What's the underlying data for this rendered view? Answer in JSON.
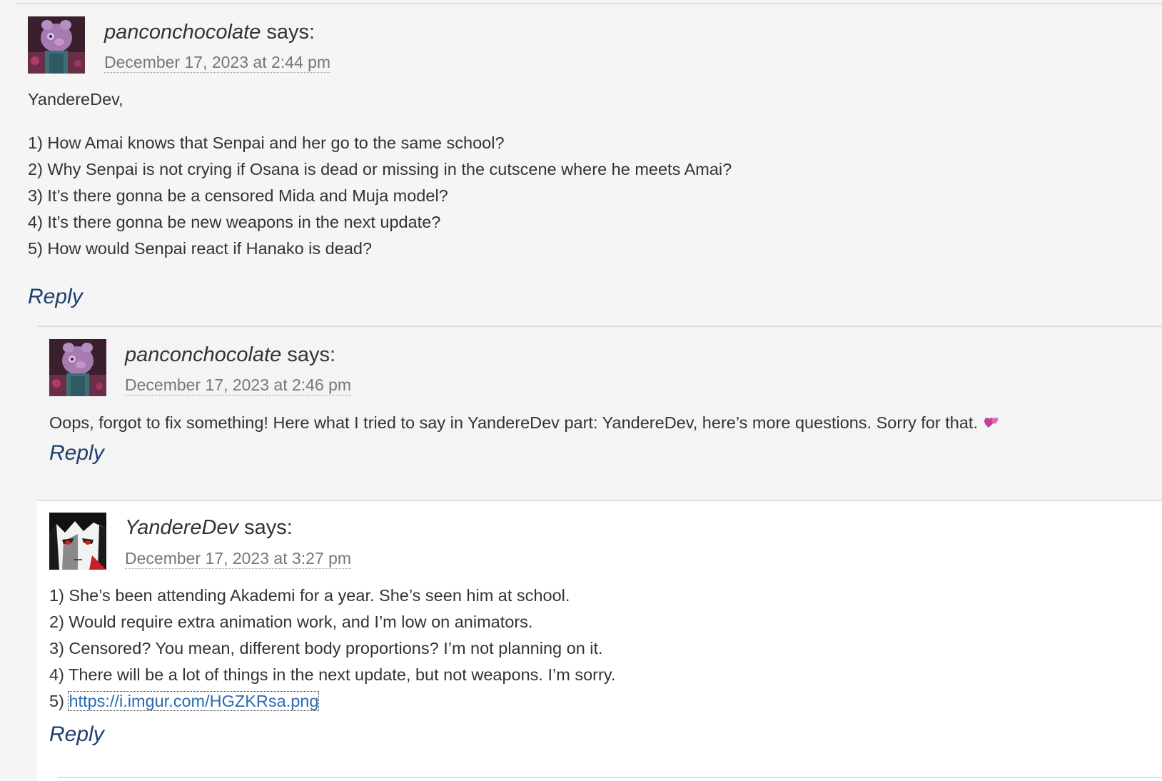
{
  "comments": [
    {
      "author": "panconchocolate",
      "says": "says:",
      "date": "December 17, 2023 at 2:44 pm",
      "avatar_icon": "pink-pig-character-avatar",
      "lines": [
        "YandereDev,",
        "1) How Amai knows that Senpai and her go to the same school?",
        "2) Why Senpai is not crying if Osana is dead or missing in the cutscene where he meets Amai?",
        "3) It’s there gonna be a censored Mida and Muja model?",
        "4) It’s there gonna be new weapons in the next update?",
        "5) How would Senpai react if Hanako is dead?"
      ],
      "reply": "Reply"
    },
    {
      "author": "panconchocolate",
      "says": "says:",
      "date": "December 17, 2023 at 2:46 pm",
      "avatar_icon": "pink-pig-character-avatar",
      "text": "Oops, forgot to fix something! Here what I tried to say in YandereDev part: YandereDev, here’s more questions. Sorry for that.",
      "emoji": "revolving-hearts-icon",
      "reply": "Reply"
    },
    {
      "author": "YandereDev",
      "says": "says:",
      "date": "December 17, 2023 at 3:27 pm",
      "avatar_icon": "anime-red-eyes-avatar",
      "lines": [
        "1) She’s been attending Akademi for a year. She’s seen him at school.",
        "2) Would require extra animation work, and I’m low on animators.",
        "3) Censored? You mean, different body proportions? I’m not planning on it.",
        "4) There will be a lot of things in the next update, but not weapons. I’m sorry."
      ],
      "last_prefix": "5)",
      "link": "https://i.imgur.com/HGZKRsa.png",
      "reply": "Reply"
    }
  ]
}
